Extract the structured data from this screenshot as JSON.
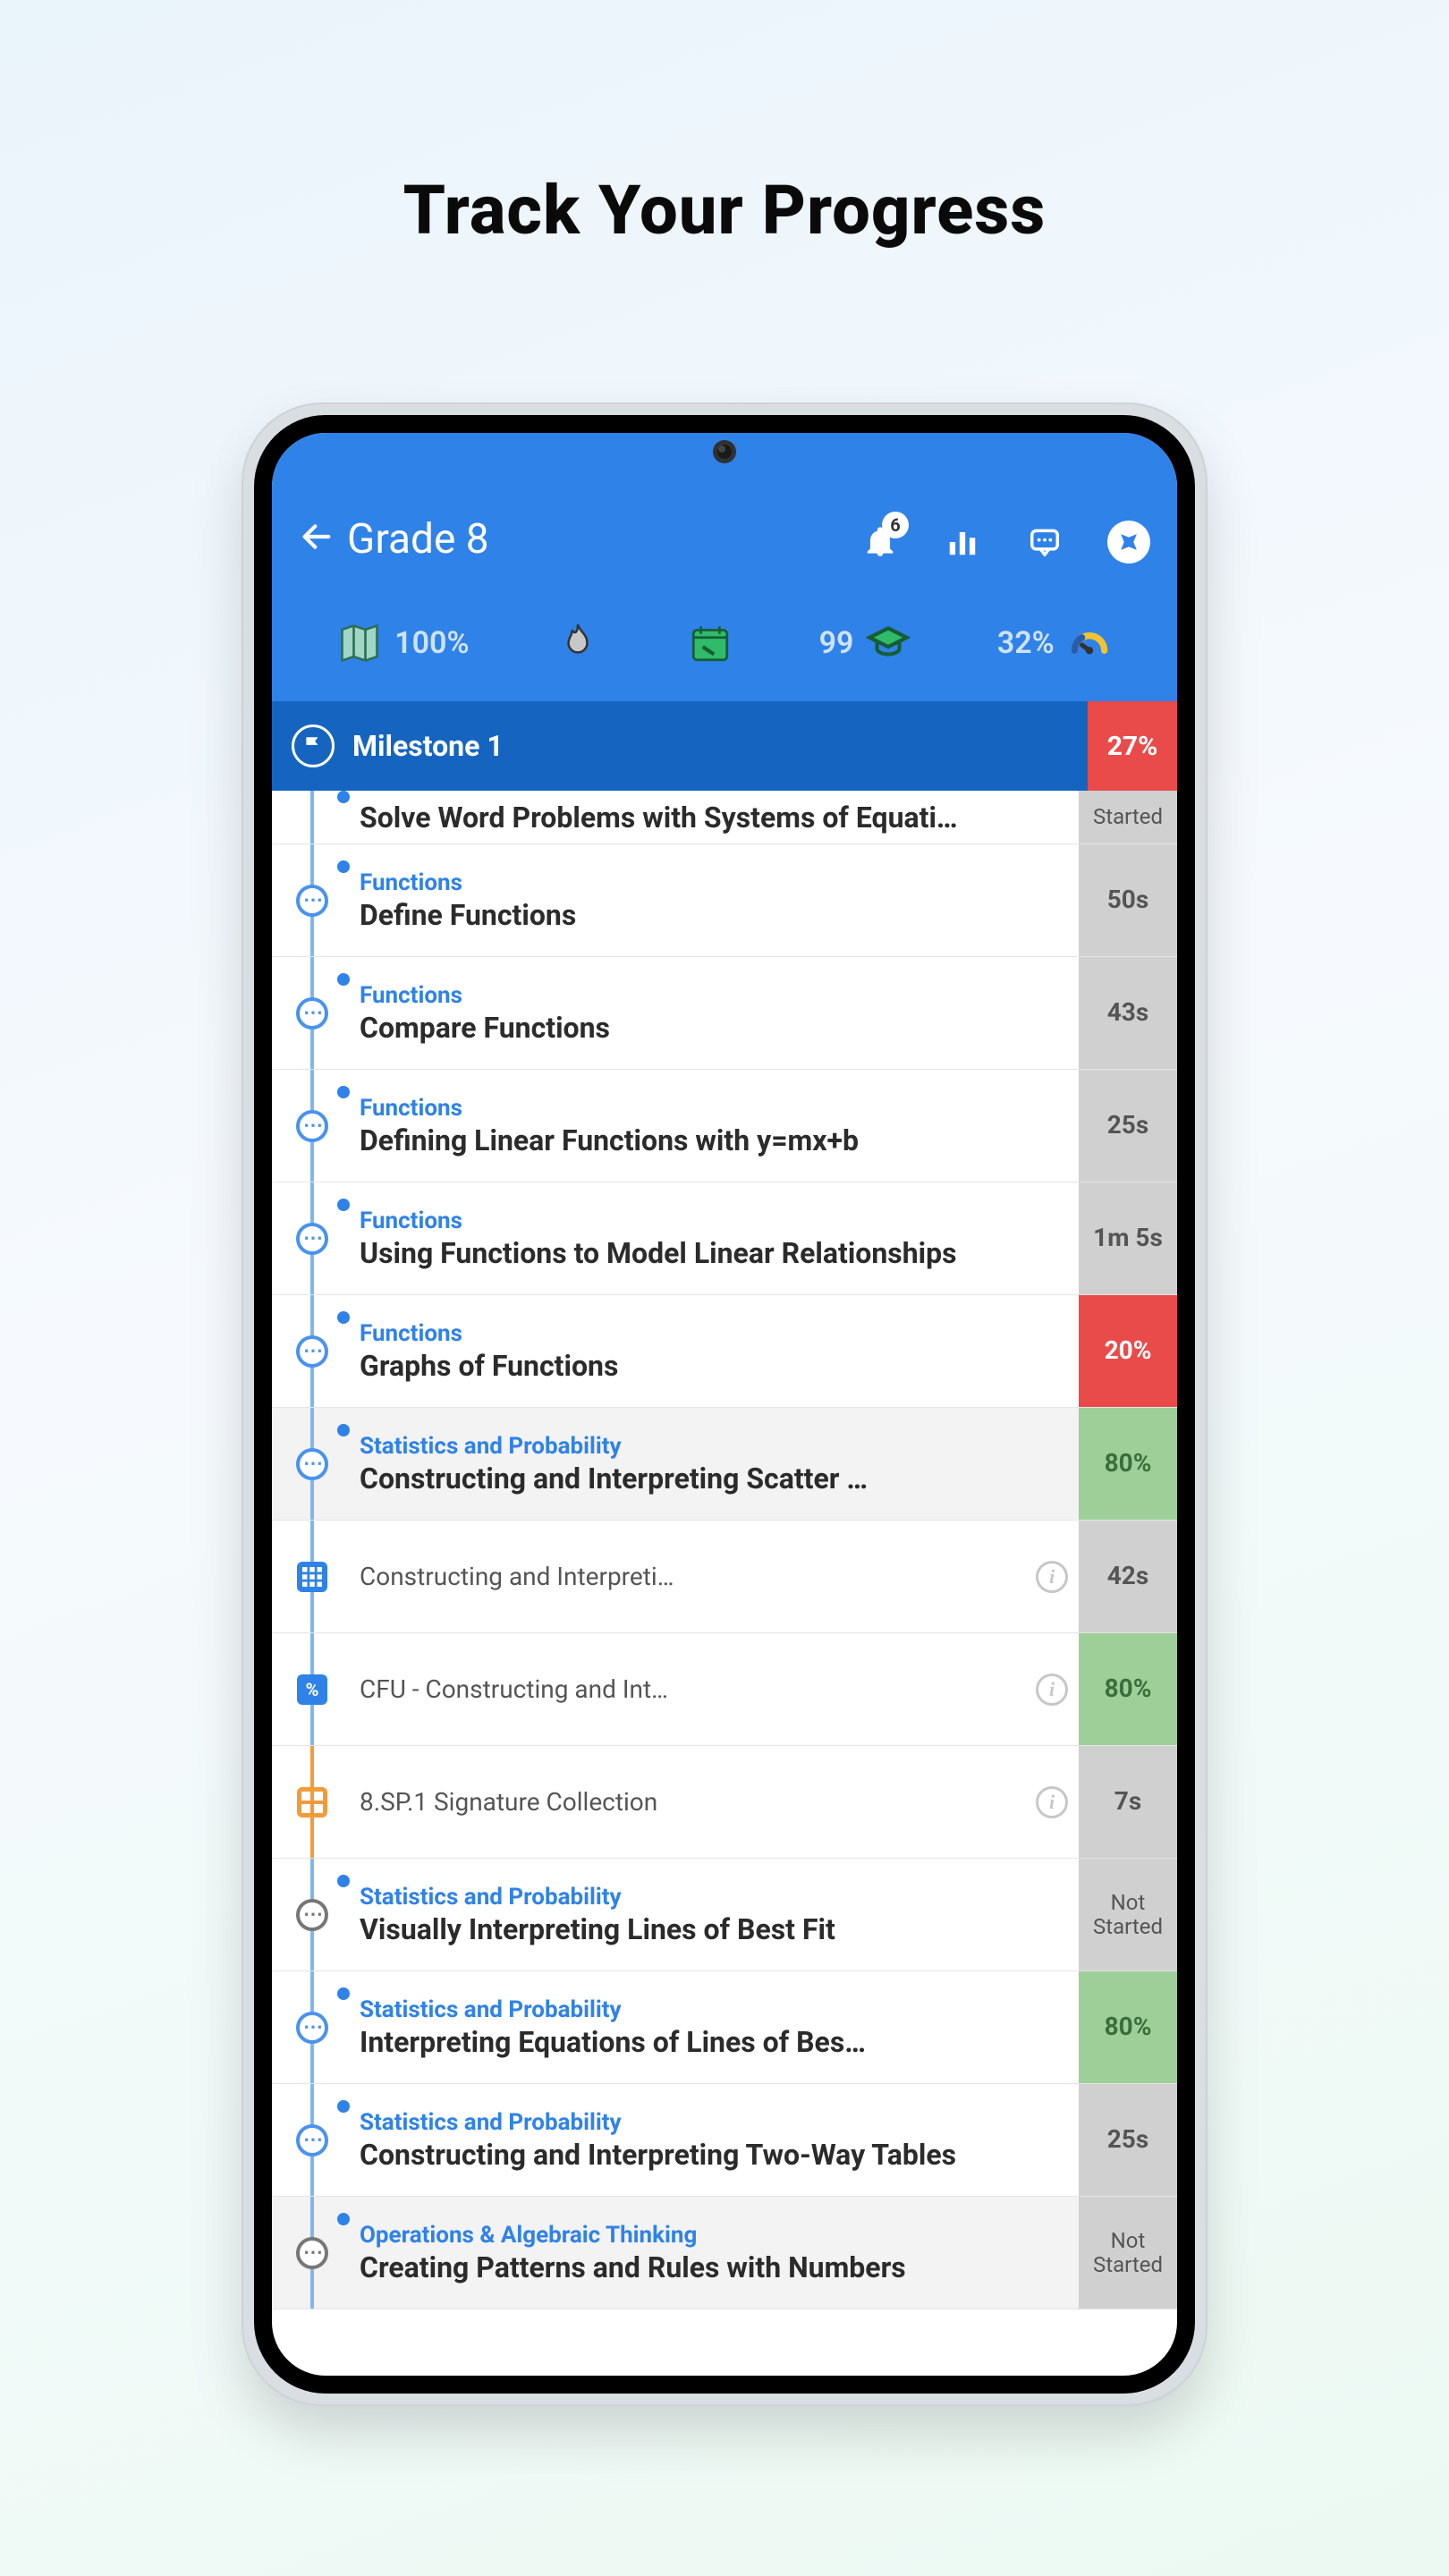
{
  "promo_title": "Track Your Progress",
  "header": {
    "title": "Grade 8",
    "badge": "6"
  },
  "metrics": {
    "map_pct": "100%",
    "points": "99",
    "speed_pct": "32%"
  },
  "milestone": {
    "title": "Milestone 1",
    "percent": "27%"
  },
  "rows": [
    {
      "type": "topic",
      "first": true,
      "shaded": false,
      "cat": "",
      "title": "Solve Word Problems with Systems of Equati…",
      "status_text": "Started",
      "status_class": "st-gray st-text"
    },
    {
      "type": "topic",
      "shaded": false,
      "cat": "Functions",
      "title": "Define Functions",
      "status_text": "50s",
      "status_class": "st-gray"
    },
    {
      "type": "topic",
      "shaded": false,
      "cat": "Functions",
      "title": "Compare Functions",
      "status_text": "43s",
      "status_class": "st-gray"
    },
    {
      "type": "topic",
      "shaded": false,
      "cat": "Functions",
      "title": "Defining Linear Functions with y=mx+b",
      "status_text": "25s",
      "status_class": "st-gray"
    },
    {
      "type": "topic",
      "shaded": false,
      "cat": "Functions",
      "title": "Using Functions to Model Linear Relationships",
      "status_text": "1m 5s",
      "status_class": "st-gray"
    },
    {
      "type": "topic",
      "shaded": false,
      "cat": "Functions",
      "title": "Graphs of Functions",
      "status_text": "20%",
      "status_class": "st-red"
    },
    {
      "type": "topic",
      "shaded": true,
      "cat": "Statistics and Probability",
      "title": "Constructing and Interpreting Scatter …",
      "status_text": "80%",
      "status_class": "st-green"
    },
    {
      "type": "sub",
      "icon": "grid",
      "title": "Constructing and Interpreti…",
      "status_text": "42s",
      "status_class": "st-gray"
    },
    {
      "type": "sub",
      "icon": "percent",
      "title": "CFU - Constructing and Int…",
      "status_text": "80%",
      "status_class": "st-green"
    },
    {
      "type": "sub",
      "icon": "collection",
      "title": "8.SP.1 Signature Collection",
      "status_text": "7s",
      "status_class": "st-gray",
      "orange_line": true
    },
    {
      "type": "topic",
      "shaded": false,
      "circle": "gray",
      "cat": "Statistics and Probability",
      "title": "Visually Interpreting Lines of Best Fit",
      "status_text": "Not Started",
      "status_class": "st-gray st-text"
    },
    {
      "type": "topic",
      "shaded": false,
      "cat": "Statistics and Probability",
      "title": "Interpreting Equations of Lines of Bes…",
      "status_text": "80%",
      "status_class": "st-green"
    },
    {
      "type": "topic",
      "shaded": false,
      "cat": "Statistics and Probability",
      "title": "Constructing and Interpreting Two-Way Tables",
      "status_text": "25s",
      "status_class": "st-gray"
    },
    {
      "type": "topic",
      "shaded": true,
      "circle": "gray",
      "cat": "Operations & Algebraic Thinking",
      "title": "Creating Patterns and Rules with Numbers",
      "status_text": "Not Started",
      "status_class": "st-gray st-text"
    }
  ]
}
